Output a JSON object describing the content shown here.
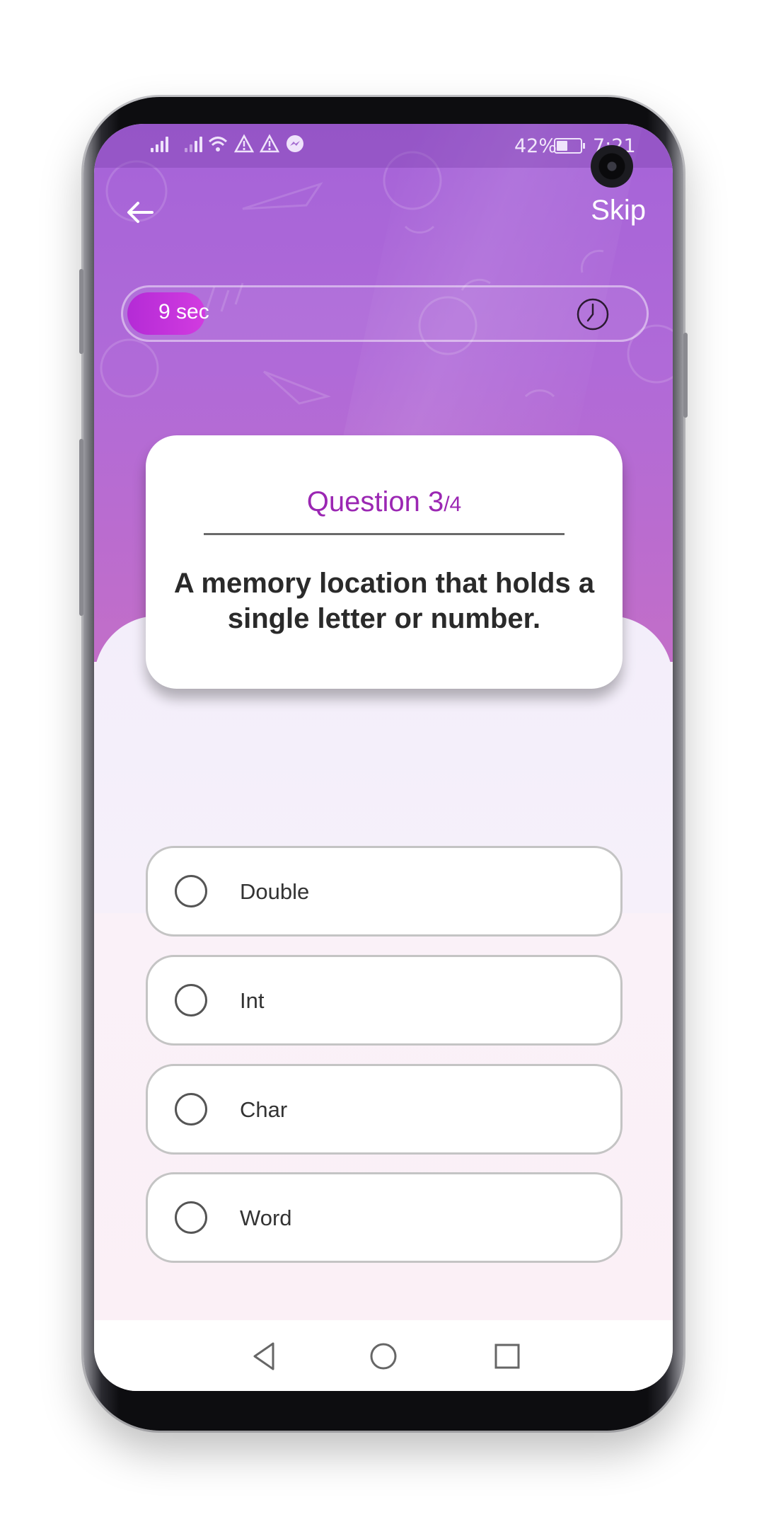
{
  "status_bar": {
    "battery": "42%",
    "time": "7:21",
    "icons": [
      "signal-icon",
      "signal-icon",
      "wifi-icon",
      "warning-icon",
      "warning-icon",
      "messenger-icon"
    ]
  },
  "header": {
    "back_icon": "arrow-left-icon",
    "skip_label": "Skip"
  },
  "timer": {
    "label": "9 sec",
    "progress": 0.11,
    "icon": "clock-icon"
  },
  "question": {
    "title_main": "Question 3",
    "title_total": "/4",
    "text": "A memory location that holds a single letter or number."
  },
  "options": [
    {
      "label": "Double"
    },
    {
      "label": "Int"
    },
    {
      "label": "Char"
    },
    {
      "label": "Word"
    }
  ],
  "nav": {
    "icons": [
      "back-triangle-icon",
      "home-circle-icon",
      "recents-square-icon"
    ]
  },
  "colors": {
    "hero_top": "#a563d8",
    "hero_bottom": "#c26ec8",
    "accent": "#9b27b3",
    "timer_fill": "#c232dc"
  }
}
